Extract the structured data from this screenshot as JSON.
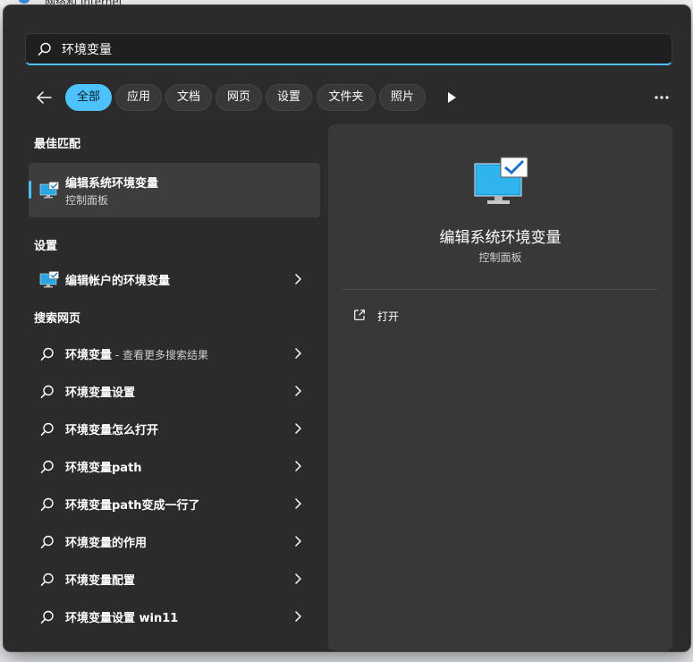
{
  "background": {
    "title": "网络和 Internet"
  },
  "search": {
    "value": "环境变量"
  },
  "filters": {
    "items": [
      {
        "label": "全部",
        "active": true
      },
      {
        "label": "应用",
        "active": false
      },
      {
        "label": "文档",
        "active": false
      },
      {
        "label": "网页",
        "active": false
      },
      {
        "label": "设置",
        "active": false
      },
      {
        "label": "文件夹",
        "active": false
      },
      {
        "label": "照片",
        "active": false
      }
    ]
  },
  "sections": {
    "best_match": "最佳匹配",
    "settings": "设置",
    "web": "搜索网页"
  },
  "best_match": {
    "title": "编辑系统环境变量",
    "subtitle": "控制面板"
  },
  "settings_items": [
    {
      "label": "编辑帐户的环境变量"
    }
  ],
  "web_results": [
    {
      "label": "环境变量",
      "suffix": " - 查看更多搜索结果"
    },
    {
      "label": "环境变量设置",
      "suffix": ""
    },
    {
      "label": "环境变量怎么打开",
      "suffix": ""
    },
    {
      "label": "环境变量path",
      "suffix": ""
    },
    {
      "label": "环境变量path变成一行了",
      "suffix": ""
    },
    {
      "label": "环境变量的作用",
      "suffix": ""
    },
    {
      "label": "环境变量配置",
      "suffix": ""
    },
    {
      "label": "环境变量设置 win11",
      "suffix": ""
    }
  ],
  "detail": {
    "title": "编辑系统环境变量",
    "subtitle": "控制面板",
    "actions": [
      {
        "label": "打开",
        "icon": "open-external-icon"
      }
    ]
  },
  "colors": {
    "accent": "#4cc2ff",
    "panel": "#2b2b2b",
    "detail_panel": "#383838"
  }
}
